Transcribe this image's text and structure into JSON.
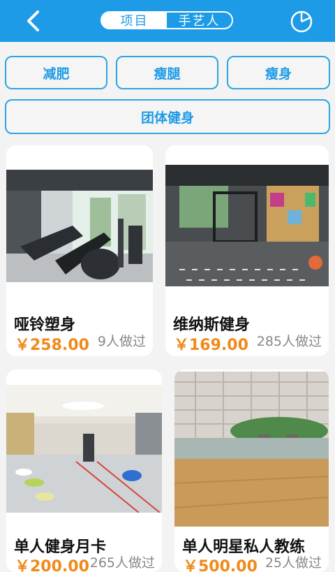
{
  "header": {
    "tabs": [
      {
        "label": "项目",
        "active": true
      },
      {
        "label": "手艺人",
        "active": false
      }
    ],
    "back_icon": "chevron-left-icon",
    "right_icon": "pie-chart-icon"
  },
  "filters": [
    "减肥",
    "瘦腿",
    "瘦身",
    "团体健身"
  ],
  "cards": [
    {
      "title": "哑铃塑身",
      "price": "￥258.00",
      "count": "9人做过"
    },
    {
      "title": "维纳斯健身",
      "price": "￥169.00",
      "count": "285人做过"
    },
    {
      "title": "单人健身月卡",
      "price": "￥200.00",
      "count": "265人做过"
    },
    {
      "title": "单人明星私人教练",
      "price": "￥500.00",
      "count": "25人做过"
    }
  ],
  "colors": {
    "accent": "#1e9be6",
    "price": "#f08a1a"
  }
}
